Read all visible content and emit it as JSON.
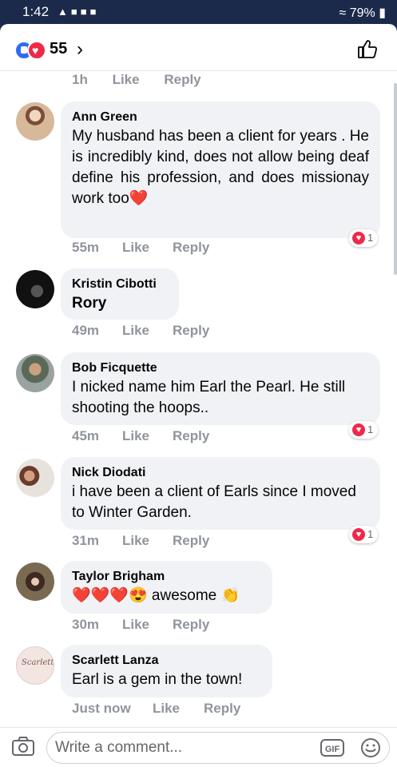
{
  "status_bar": {
    "time": "1:42",
    "battery": "79%"
  },
  "header": {
    "reaction_count": "55"
  },
  "top_meta": {
    "time": "1h",
    "like": "Like",
    "reply": "Reply"
  },
  "comments": [
    {
      "author": "Ann Green",
      "text": "My husband has been a client for years . He is incredibly kind, does not allow being deaf define his profession, and does missionay work too❤️",
      "time": "55m",
      "like": "Like",
      "reply": "Reply",
      "reactions": "1"
    },
    {
      "author": "Kristin Cibotti",
      "text": "Rory",
      "time": "49m",
      "like": "Like",
      "reply": "Reply"
    },
    {
      "author": "Bob Ficquette",
      "text": "I nicked name him Earl the Pearl. He still shooting the hoops..",
      "time": "45m",
      "like": "Like",
      "reply": "Reply",
      "reactions": "1"
    },
    {
      "author": "Nick Diodati",
      "text": "i have been a client of Earls since I moved to Winter Garden.",
      "time": "31m",
      "like": "Like",
      "reply": "Reply",
      "reactions": "1"
    },
    {
      "author": "Taylor Brigham",
      "text": "❤️❤️❤️😍 awesome 👏",
      "time": "30m",
      "like": "Like",
      "reply": "Reply"
    },
    {
      "author": "Scarlett Lanza",
      "text": "Earl is a gem in the town!",
      "time": "Just now",
      "like": "Like",
      "reply": "Reply"
    }
  ],
  "composer": {
    "placeholder": "Write a comment...",
    "gif_label": "GIF"
  },
  "colors": {
    "bubble": "#f0f2f5",
    "meta": "#90949c",
    "like_blue": "#2f6bf0",
    "love_red": "#f0284a",
    "status_bar": "#1b2a4a"
  },
  "icons": {
    "react_like": "like-reaction-icon",
    "react_love": "love-reaction-icon",
    "thumb": "thumbs-up-icon",
    "camera": "camera-icon",
    "smiley": "smiley-icon"
  }
}
